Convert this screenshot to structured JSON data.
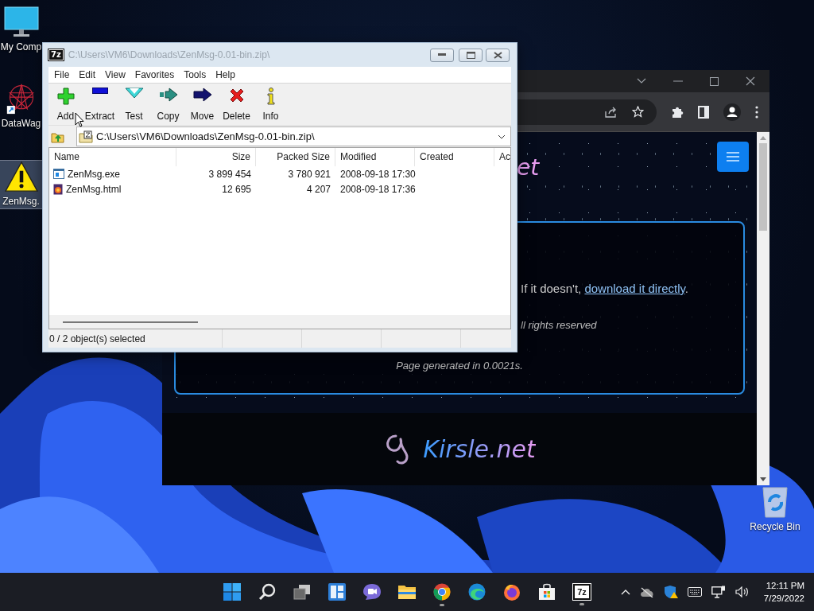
{
  "desktop": {
    "icons": [
      {
        "kind": "monitor",
        "label": "My Comp",
        "selected": false
      },
      {
        "kind": "app",
        "label": "DataWag",
        "selected": false
      },
      {
        "kind": "warning",
        "label": "ZenMsg.",
        "selected": true
      },
      {
        "kind": "recycle",
        "label": "Recycle Bin",
        "selected": false
      }
    ]
  },
  "browser": {
    "page": {
      "logo_fragment": "et",
      "message_lead": "If it doesn't, ",
      "message_link": "download it directly",
      "message_end": ".",
      "rights": "ll rights reserved",
      "generated": "Page generated in 0.0021s.",
      "footer_logo": "Kirsle.net"
    }
  },
  "archive_window": {
    "badge": "7z",
    "title": "C:\\Users\\VM6\\Downloads\\ZenMsg-0.01-bin.zip\\",
    "active": false,
    "menu": [
      "File",
      "Edit",
      "View",
      "Favorites",
      "Tools",
      "Help"
    ],
    "toolbar": [
      {
        "kind": "add",
        "label": "Add"
      },
      {
        "kind": "extract",
        "label": "Extract"
      },
      {
        "kind": "test",
        "label": "Test"
      },
      {
        "kind": "copy",
        "label": "Copy"
      },
      {
        "kind": "move",
        "label": "Move"
      },
      {
        "kind": "delete",
        "label": "Delete"
      },
      {
        "kind": "info",
        "label": "Info"
      }
    ],
    "address": "C:\\Users\\VM6\\Downloads\\ZenMsg-0.01-bin.zip\\",
    "columns": [
      "Name",
      "Size",
      "Packed Size",
      "Modified",
      "Created",
      "Ac"
    ],
    "rows": [
      {
        "kind": "exe",
        "name": "ZenMsg.exe",
        "size": "3 899 454",
        "packed_size": "3 780 921",
        "modified": "2008-09-18 17:30"
      },
      {
        "kind": "html",
        "name": "ZenMsg.html",
        "size": "12 695",
        "packed_size": "4 207",
        "modified": "2008-09-18 17:36"
      }
    ],
    "status": "0 / 2 object(s) selected"
  },
  "taskbar": {
    "apps": [
      {
        "kind": "start",
        "running": false
      },
      {
        "kind": "search",
        "running": false
      },
      {
        "kind": "task-view",
        "running": false
      },
      {
        "kind": "widgets",
        "running": false
      },
      {
        "kind": "chat",
        "running": false
      },
      {
        "kind": "files",
        "running": false
      },
      {
        "kind": "chrome",
        "running": true
      },
      {
        "kind": "edge",
        "running": false
      },
      {
        "kind": "firefox",
        "running": false
      },
      {
        "kind": "store",
        "running": false
      },
      {
        "kind": "archiver",
        "running": true,
        "badge": "7z"
      }
    ],
    "clock": {
      "time": "12:11 PM",
      "date": "7/29/2022"
    }
  }
}
